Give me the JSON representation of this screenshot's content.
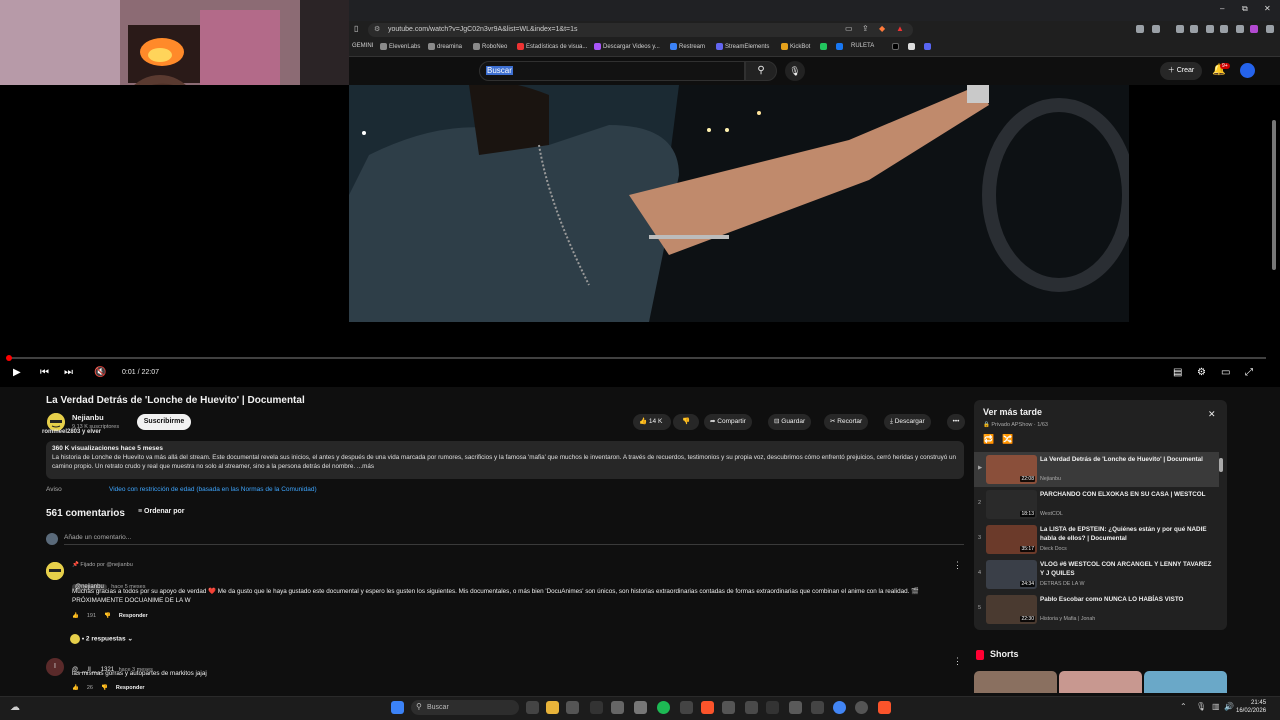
{
  "browser": {
    "url": "youtube.com/watch?v=JgC02n3vr9A&list=WL&index=1&t=1s",
    "bookmarks": [
      "GEMINI",
      "ElevenLabs",
      "dreamina",
      "RoboNeo",
      "Estadísticas de visua...",
      "Descargar Videos y...",
      "Restream",
      "StreamElements",
      "KickBot",
      "RULETA"
    ]
  },
  "header": {
    "search_text": "Buscar",
    "create_label": "Crear",
    "notif_badge": "9+"
  },
  "player": {
    "time": "0:01 / 22:07",
    "progress": 0.0008
  },
  "video": {
    "title": "La Verdad Detrás de 'Lonche de Huevito' | Documental",
    "channel": "Nejianbu",
    "subs": "9,13 K suscriptores",
    "subscribe_label": "Suscribirme",
    "overlay_name": "rommeel2803 y elver",
    "likes": "14 K",
    "share_label": "Compartir",
    "save_label": "Guardar",
    "clip_label": "Recortar",
    "download_label": "Descargar",
    "views_meta": "360 K visualizaciones  hace 5 meses",
    "description": "La historia de Lonche de Huevito va más allá del stream. Este documental revela sus inicios, el antes y después de una vida marcada por rumores, sacrificios y la famosa 'mafia' que muchos le inventaron. A través de recuerdos, testimonios y su propia voz, descubrimos cómo enfrentó prejuicios, cerró heridas y construyó un camino propio. Un retrato crudo y real que muestra no solo al streamer, sino a la persona detrás del nombre. ...más",
    "notice_label": "Aviso",
    "notice_text": "Video con restricción de edad (basada en las Normas de la Comunidad)"
  },
  "comments": {
    "count": "561 comentarios",
    "sort_label": "Ordenar por",
    "add_placeholder": "Añade un comentario...",
    "items": [
      {
        "pinned": "Fijado por @nejianbu",
        "author": "@nejianbu",
        "time": "hace 5 meses",
        "text": "Muchas gracias a todos por su apoyo de verdad ❤️ Me da gusto que le haya gustado este documental y espero les gusten los siguientes. Mis documentales, o más bien 'DocuAnimes' son únicos, son historias extraordinarias contadas de formas extraordinarias que combinan el anime con la realidad. 🎬 PRÓXIMAMENTE DOCUANIME DE LA W",
        "likes": "191",
        "reply_label": "Responder",
        "replies": "• 2 respuestas"
      },
      {
        "author": "@___ll___1321",
        "time": "hace 3 meses",
        "text": "las mismas gorras y autopartes de markitos jajaj",
        "likes": "26",
        "reply_label": "Responder"
      }
    ]
  },
  "playlist": {
    "title": "Ver más tarde",
    "owner": "Privado APShow · 1/63",
    "items": [
      {
        "index": "▶",
        "title": "La Verdad Detrás de 'Lonche de Huevito' | Documental",
        "channel": "Nejianbu",
        "duration": "22:08",
        "thumb_color": "#8a4f3a"
      },
      {
        "index": "2",
        "title": "PARCHANDO CON ELXOKAS EN SU CASA | WESTCOL",
        "channel": "WestCOL",
        "duration": "18:13",
        "thumb_color": "#2a2a2a"
      },
      {
        "index": "3",
        "title": "La LISTA de EPSTEIN: ¿Quiénes están y por qué NADIE habla de ellos? | Documental",
        "channel": "Dieck Docs",
        "duration": "35:17",
        "thumb_color": "#6b3a2a"
      },
      {
        "index": "4",
        "title": "VLOG #6 WESTCOL CON ARCANGEL Y LENNY TAVAREZ Y J QUILES",
        "channel": "DETRAS DE LA W",
        "duration": "24:34",
        "thumb_color": "#3a3f48"
      },
      {
        "index": "5",
        "title": "Pablo Escobar como NUNCA LO HABÍAS VISTO",
        "channel": "Historia y Mafia | Jonah",
        "duration": "22:30",
        "thumb_color": "#4a3a30"
      }
    ]
  },
  "shorts": {
    "title": "Shorts"
  },
  "taskbar": {
    "search": "Buscar",
    "time": "21:45",
    "date": "16/02/2026"
  },
  "colors": {
    "accent": "#ff0000",
    "link": "#3ea6ff",
    "bg": "#0f0f0f"
  }
}
